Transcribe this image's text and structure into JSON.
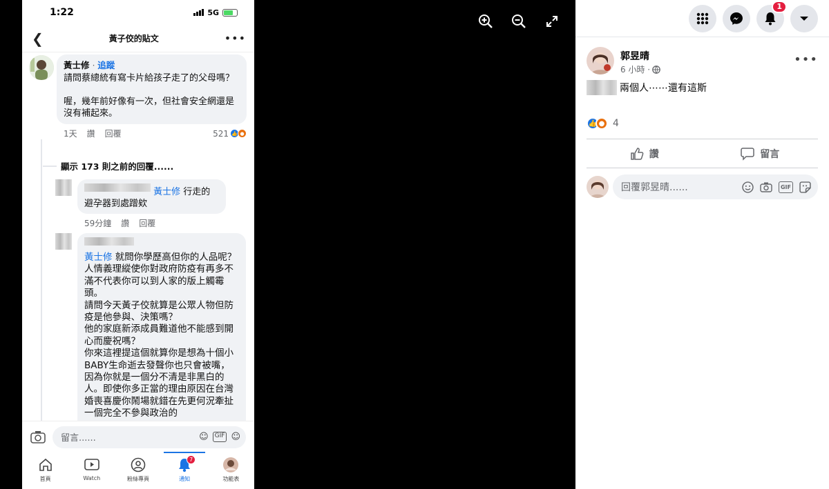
{
  "phone": {
    "status": {
      "time": "1:22",
      "network": "5G"
    },
    "nav": {
      "title": "黃子佼的貼文"
    },
    "comments": [
      {
        "author": "黃士修",
        "follow": "追蹤",
        "text": "請問蔡總統有寫卡片給孩子走了的父母嗎？\n\n喔，幾年前好像有一次，但社會安全網還是沒有補起來。",
        "time": "1天",
        "like": "讚",
        "reply": "回覆",
        "count": "521"
      }
    ],
    "show_previous": "顯示 173 則之前的回覆......",
    "replies": [
      {
        "tag": "黃士修",
        "text": " 行走的避孕器到處蹭欸",
        "time": "59分鐘",
        "like": "讚",
        "reply": "回覆"
      },
      {
        "tag": "黃士修",
        "text": " 就問你學歷高但你的人品呢？\n人情義理縱使你對政府防疫有再多不滿不代表你可以到人家的版上觸霉頭。\n請問今天黃子佼就算是公眾人物但防疫是他參與、決策嗎？\n他的家庭新添成員難道他不能感到開心而慶祝嗎？\n你來這裡提這個就算你是想為十個小BABY生命逝去發聲你也只會被嘴，因為你就是一個分不清是非黑白的人。即使你多正當的理由原因在台灣婚喪喜慶你鬧場就錯在先更何況牽扯一個完全不參與政治的"
      }
    ],
    "composer": {
      "placeholder": "留言......",
      "gif": "GIF"
    },
    "tabs": [
      {
        "label": "首頁",
        "icon": "home-icon"
      },
      {
        "label": "Watch",
        "icon": "watch-icon"
      },
      {
        "label": "粉絲專頁",
        "icon": "pages-icon"
      },
      {
        "label": "通知",
        "icon": "bell-icon",
        "badge": "7",
        "active": true
      },
      {
        "label": "功能表",
        "icon": "profile-menu-icon"
      }
    ]
  },
  "viewer": {
    "tools": [
      "zoom-in-icon",
      "zoom-out-icon",
      "expand-icon"
    ]
  },
  "side": {
    "nav": {
      "notification_count": "1"
    },
    "post": {
      "author": "郭昱晴",
      "time": "6 小時 ·",
      "text": "兩個人⋯⋯還有這斯",
      "reaction_count": "4"
    },
    "actions": {
      "like": "讚",
      "comment": "留言"
    },
    "reply": {
      "placeholder": "回覆郭昱晴......",
      "gif": "GIF"
    }
  },
  "colors": {
    "accent": "#1b74e4",
    "badge": "#e41e3f",
    "bubble": "#f0f2f5"
  }
}
